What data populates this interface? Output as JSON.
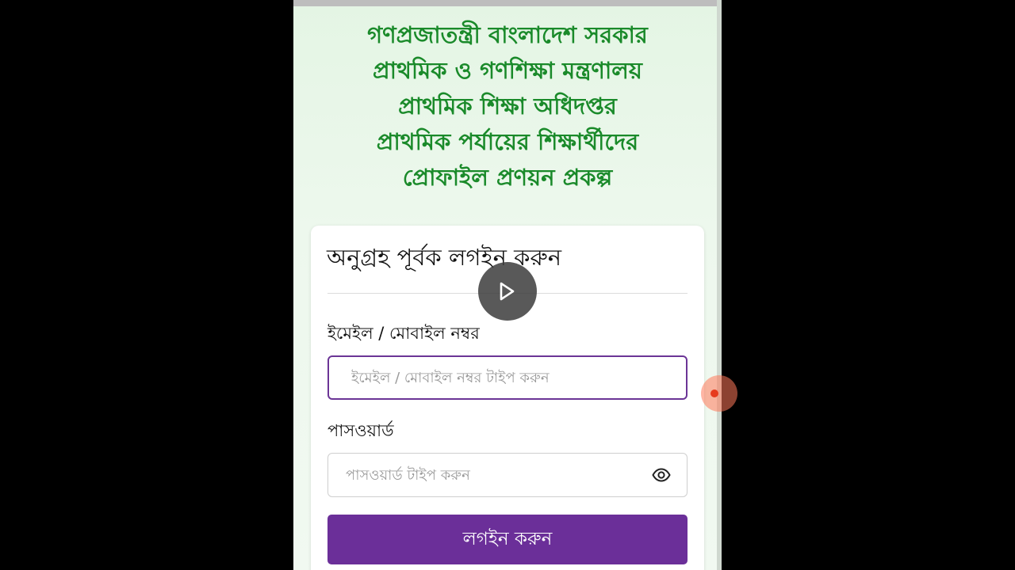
{
  "header": {
    "lines": [
      "গণপ্রজাতন্ত্রী বাংলাদেশ সরকার",
      "প্রাথমিক ও গণশিক্ষা মন্ত্রণালয়",
      "প্রাথমিক শিক্ষা অধিদপ্তর",
      "প্রাথমিক পর্যায়ের শিক্ষার্থীদের",
      "প্রোফাইল প্রণয়ন প্রকল্প"
    ]
  },
  "login": {
    "title": "অনুগ্রহ পূর্বক লগইন করুন",
    "email_label": "ইমেইল / মোবাইল নম্বর",
    "email_placeholder": "ইমেইল / মোবাইল নম্বর টাইপ করুন",
    "email_value": "",
    "password_label": "পাসওয়ার্ড",
    "password_placeholder": "পাসওয়ার্ড টাইপ করুন",
    "password_value": "",
    "submit_label": "লগইন করুন"
  },
  "icons": {
    "password_toggle": "eye-icon",
    "video_play": "play-icon",
    "record": "record-dot-icon"
  },
  "colors": {
    "header_text": "#1a8a2a",
    "accent": "#6b2f99",
    "background": "#e8f6e8"
  }
}
